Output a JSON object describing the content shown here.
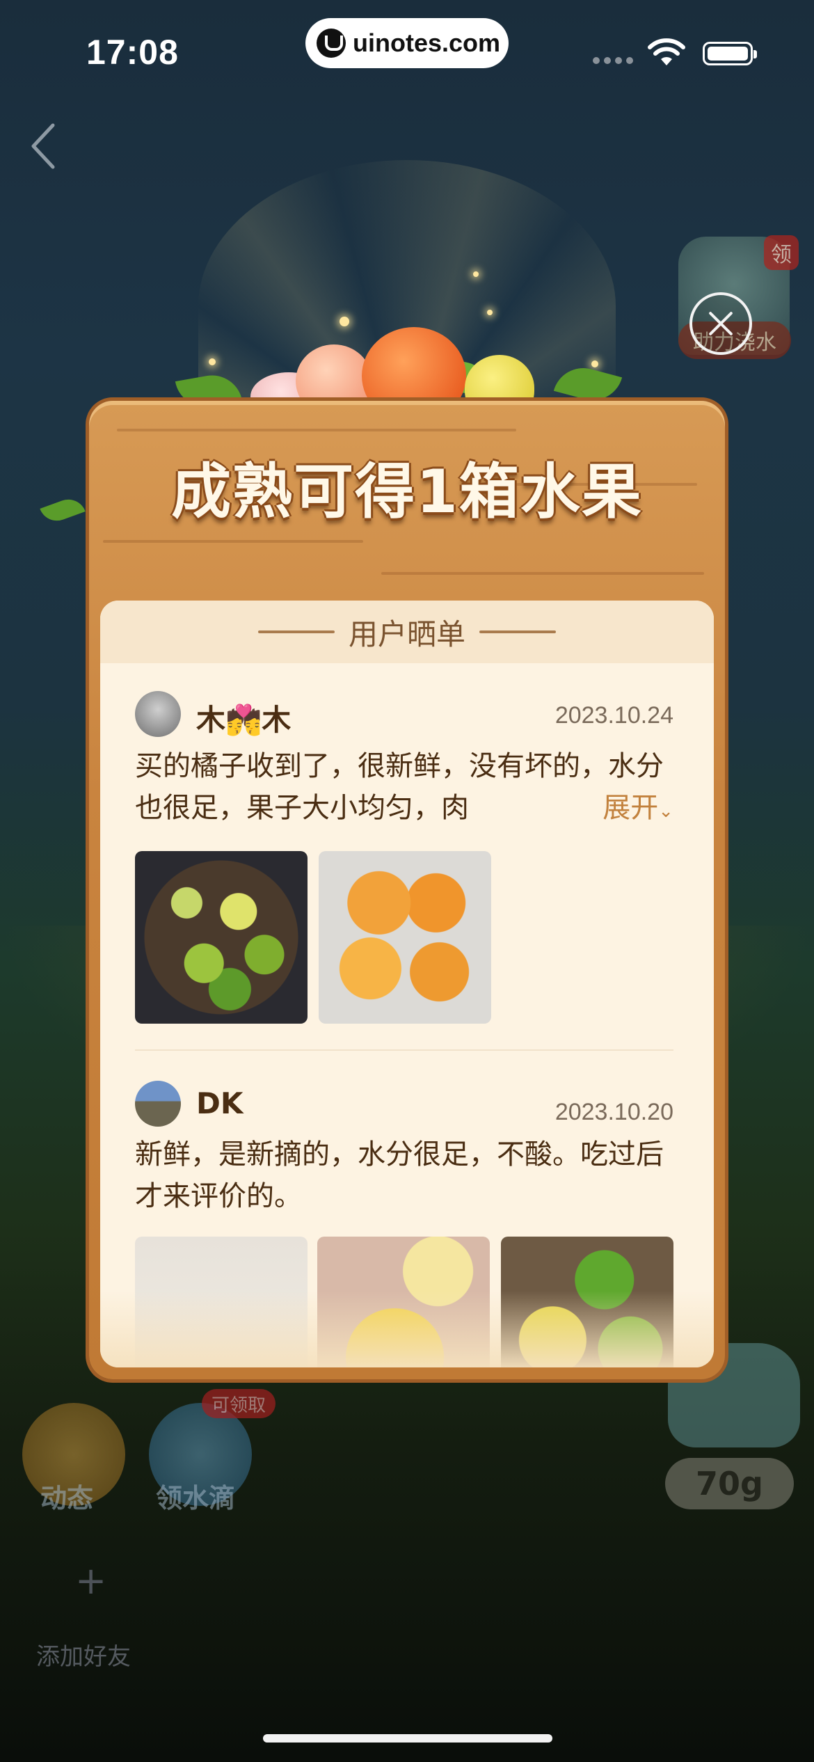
{
  "status_bar": {
    "time": "17:08",
    "site": "uinotes.com"
  },
  "game": {
    "bottle_badge": "领",
    "bottle_label": "助力浇水",
    "buttons": [
      {
        "label": "动态"
      },
      {
        "label": "领水滴",
        "badge": "可领取"
      }
    ],
    "water_amount": "70g",
    "add_friend_label": "添加好友",
    "add_friend_icon": "+"
  },
  "modal": {
    "title": "成熟可得1箱水果",
    "section_title": "用户晒单",
    "reviews": [
      {
        "name": "木💏木",
        "date": "2023.10.24",
        "text": "买的橘子收到了，很新鲜，没有坏的，水分也很足，果子大小均匀，肉",
        "expand_label": "展开"
      },
      {
        "name": "DK",
        "date": "2023.10.20",
        "text": "新鲜，是新摘的，水分很足，不酸。吃过后才来评价的。"
      }
    ]
  }
}
